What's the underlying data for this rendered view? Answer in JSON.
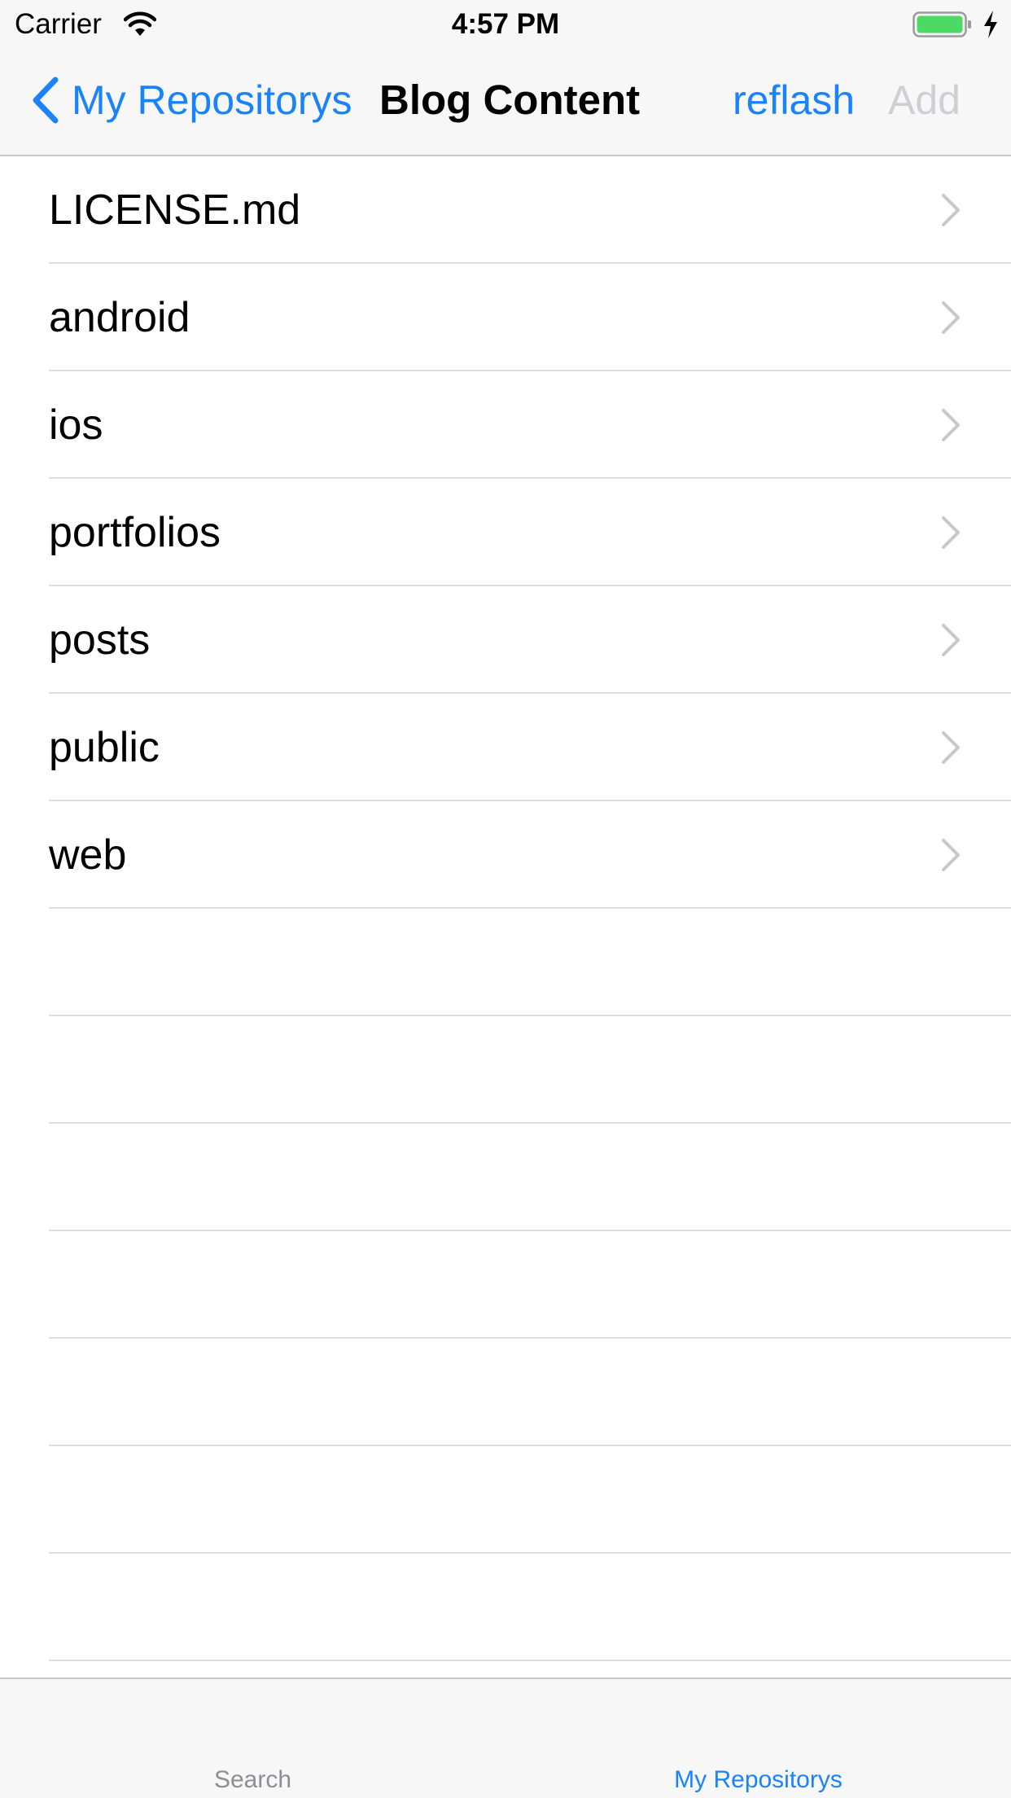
{
  "status_bar": {
    "carrier": "Carrier",
    "time": "4:57 PM",
    "icons": [
      "wifi-icon",
      "battery-icon",
      "charging-bolt-icon"
    ],
    "battery_color": "#4cd964"
  },
  "nav_bar": {
    "back_label": "My Repositorys",
    "title": "Blog Content",
    "reflash_label": "reflash",
    "add_label": "Add",
    "tint_color": "#1a82fb",
    "disabled_color": "#cfcfd3"
  },
  "table": {
    "rows": [
      {
        "label": "LICENSE.md"
      },
      {
        "label": "android"
      },
      {
        "label": "ios"
      },
      {
        "label": "portfolios"
      },
      {
        "label": "posts"
      },
      {
        "label": "public"
      },
      {
        "label": "web"
      }
    ]
  },
  "tab_bar": {
    "tabs": [
      {
        "label": "Search",
        "selected": false
      },
      {
        "label": "My Repositorys",
        "selected": true
      }
    ]
  }
}
